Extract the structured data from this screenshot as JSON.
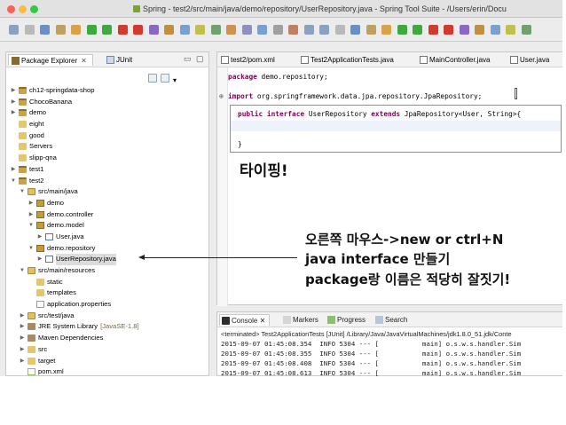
{
  "window": {
    "title": "Spring - test2/src/main/java/demo/repository/UserRepository.java - Spring Tool Suite - /Users/erin/Docu"
  },
  "package_explorer": {
    "tab_label": "Package Explorer",
    "tab_close": "✕",
    "junit_tab": "JUnit",
    "minimize": "▭",
    "maximize": "▢",
    "tree": [
      {
        "label": "ch12-springdata-shop",
        "icon": "project-icon",
        "depth": 0,
        "arrow": "▶"
      },
      {
        "label": "ChocoBanana",
        "icon": "project-icon",
        "depth": 0,
        "arrow": "▶"
      },
      {
        "label": "demo",
        "icon": "project-icon",
        "depth": 0,
        "arrow": "▶"
      },
      {
        "label": "eight",
        "icon": "folder-icon",
        "depth": 0,
        "arrow": ""
      },
      {
        "label": "good",
        "icon": "folder-icon",
        "depth": 0,
        "arrow": ""
      },
      {
        "label": "Servers",
        "icon": "folder-icon",
        "depth": 0,
        "arrow": ""
      },
      {
        "label": "slipp-qna",
        "icon": "folder-icon",
        "depth": 0,
        "arrow": ""
      },
      {
        "label": "test1",
        "icon": "project-icon",
        "depth": 0,
        "arrow": "▶"
      },
      {
        "label": "test2",
        "icon": "project-icon",
        "depth": 0,
        "arrow": "▼"
      },
      {
        "label": "src/main/java",
        "icon": "source-folder-icon",
        "depth": 1,
        "arrow": "▼"
      },
      {
        "label": "demo",
        "icon": "package-icon",
        "depth": 2,
        "arrow": "▶"
      },
      {
        "label": "demo.controller",
        "icon": "package-icon",
        "depth": 2,
        "arrow": "▶"
      },
      {
        "label": "demo.model",
        "icon": "package-icon",
        "depth": 2,
        "arrow": "▼"
      },
      {
        "label": "User.java",
        "icon": "java-file-icon",
        "depth": 3,
        "arrow": "▶"
      },
      {
        "label": "demo.repository",
        "icon": "package-icon",
        "depth": 2,
        "arrow": "▼"
      },
      {
        "label": "UserRepository.java",
        "icon": "java-file-icon",
        "depth": 3,
        "arrow": "▶",
        "selected": true
      },
      {
        "label": "src/main/resources",
        "icon": "source-folder-icon",
        "depth": 1,
        "arrow": "▼"
      },
      {
        "label": "static",
        "icon": "folder-icon",
        "depth": 2,
        "arrow": ""
      },
      {
        "label": "templates",
        "icon": "folder-icon",
        "depth": 2,
        "arrow": ""
      },
      {
        "label": "application.properties",
        "icon": "properties-file-icon",
        "depth": 2,
        "arrow": ""
      },
      {
        "label": "src/test/java",
        "icon": "source-folder-icon",
        "depth": 1,
        "arrow": "▶"
      },
      {
        "label": "JRE System Library",
        "extra": "[JavaSE-1.8]",
        "icon": "library-icon",
        "depth": 1,
        "arrow": "▶"
      },
      {
        "label": "Maven Dependencies",
        "icon": "library-icon",
        "depth": 1,
        "arrow": "▶"
      },
      {
        "label": "src",
        "icon": "folder-icon",
        "depth": 1,
        "arrow": "▶"
      },
      {
        "label": "target",
        "icon": "folder-icon",
        "depth": 1,
        "arrow": "▶"
      },
      {
        "label": "pom.xml",
        "icon": "xml-file-icon",
        "depth": 1,
        "arrow": ""
      }
    ]
  },
  "editor": {
    "tabs": [
      {
        "label": "test2/pom.xml",
        "active": false
      },
      {
        "label": "Test2ApplicationTests.java",
        "active": false
      },
      {
        "label": "MainController.java",
        "active": false
      },
      {
        "label": "User.java",
        "active": false
      }
    ],
    "code": {
      "line1_kw": "package",
      "line1_rest": " demo.repository;",
      "line2_fold": "⊕",
      "line2_kw": "import",
      "line2_rest": " org.springframework.data.jpa.repository.JpaRepository;",
      "line3_kw1": "public",
      "line3_kw2": "interface",
      "line3_name": " UserRepository ",
      "line3_kw3": "extends",
      "line3_rest": " JpaRepository<User, String>{",
      "line5": "}"
    }
  },
  "annotations": {
    "typing": "타이핑!",
    "line1": "오른쪽 마우스->new or ctrl+N",
    "line2": "java interface 만들기",
    "line3": "package랑 이름은 적당히 잘짓기!"
  },
  "console": {
    "tabs": [
      "Console",
      "Markers",
      "Progress",
      "Search"
    ],
    "tab_close": "✕",
    "terminated": "<terminated> Test2ApplicationTests [JUnit] /Library/Java/JavaVirtualMachines/jdk1.8.0_51.jdk/Conte",
    "logs": [
      "2015-09-07 01:45:08.354  INFO 5304 --- [           main] o.s.w.s.handler.Sim",
      "2015-09-07 01:45:08.355  INFO 5304 --- [           main] o.s.w.s.handler.Sim",
      "2015-09-07 01:45:08.408  INFO 5304 --- [           main] o.s.w.s.handler.Sim",
      "2015-09-07 01:45:08.613  INFO 5304 --- [           main] o.s.w.s.handler.Sim"
    ]
  },
  "colors": {
    "keyword": "#7f0055",
    "toolbar_green": "#3fa93f",
    "toolbar_red": "#d23a30"
  }
}
